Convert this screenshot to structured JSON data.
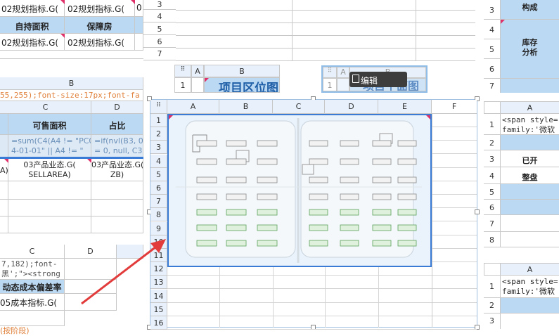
{
  "left_top": {
    "row1": [
      "02规划指标.G(",
      "02规划指标.G(",
      "0"
    ],
    "row2": [
      "自持面积",
      "保障房"
    ],
    "row3": [
      "02规划指标.G(",
      "02规划指标.G("
    ]
  },
  "left_mid": {
    "col_b": "B",
    "style_text": "55,255);font-size:17px;font-fa",
    "cols": [
      "C",
      "D"
    ],
    "headers": [
      "可售面积",
      "占比"
    ],
    "formula1": [
      "=sum(C4(A4 != \"PC0",
      "4-01-01\" || A4 != \""
    ],
    "formula2": [
      "=if(nvl(B3, 0)",
      "= 0, null, C3 /"
    ],
    "cells_a": "A)",
    "cells_c": [
      "03产品业态.G(",
      "SELLAREA)"
    ],
    "cells_d": [
      "03产品业态.G(",
      "ZB)"
    ]
  },
  "left_bottom": {
    "cols": [
      "C",
      "D"
    ],
    "code1": "7,182);font-",
    "code2": "黑';\"><strong",
    "header": "动态成本偏差率",
    "value": "05成本指标.G(",
    "footer": "(按阶段)"
  },
  "center_top_rows": [
    "3",
    "4",
    "5",
    "6",
    "7"
  ],
  "mini1": {
    "cols": [
      "A",
      "B"
    ],
    "row": "1",
    "title": "项目区位图"
  },
  "mini2": {
    "cols": [
      "A",
      "B"
    ],
    "row": "1",
    "title": "项目平面图"
  },
  "edit_button": "编辑",
  "main_grid": {
    "cols": [
      "A",
      "B",
      "C",
      "D",
      "E",
      "F"
    ],
    "rows": [
      "1",
      "2",
      "3",
      "4",
      "5",
      "6",
      "7",
      "8",
      "9",
      "10",
      "11",
      "12",
      "13",
      "14",
      "15",
      "16"
    ]
  },
  "right_top": {
    "rows": [
      "3",
      "4",
      "5",
      "6",
      "7"
    ],
    "label1": "构成",
    "label2a": "库存",
    "label2b": "分析"
  },
  "right_mid": {
    "col": "A",
    "rows": [
      "1",
      "2",
      "3",
      "4",
      "5",
      "6",
      "7",
      "8"
    ],
    "code1": "<span style=",
    "code2": "family:'微软",
    "cell3": "已开",
    "cell4": "整盘"
  },
  "right_bottom": {
    "col": "A",
    "rows": [
      "1",
      "2",
      "3"
    ],
    "code1": "<span style=",
    "code2": "family:'微软"
  },
  "colors": {
    "accent": "#3a7bd5",
    "header_blue": "#bcd9f3",
    "arrow": "#e23b3b"
  }
}
